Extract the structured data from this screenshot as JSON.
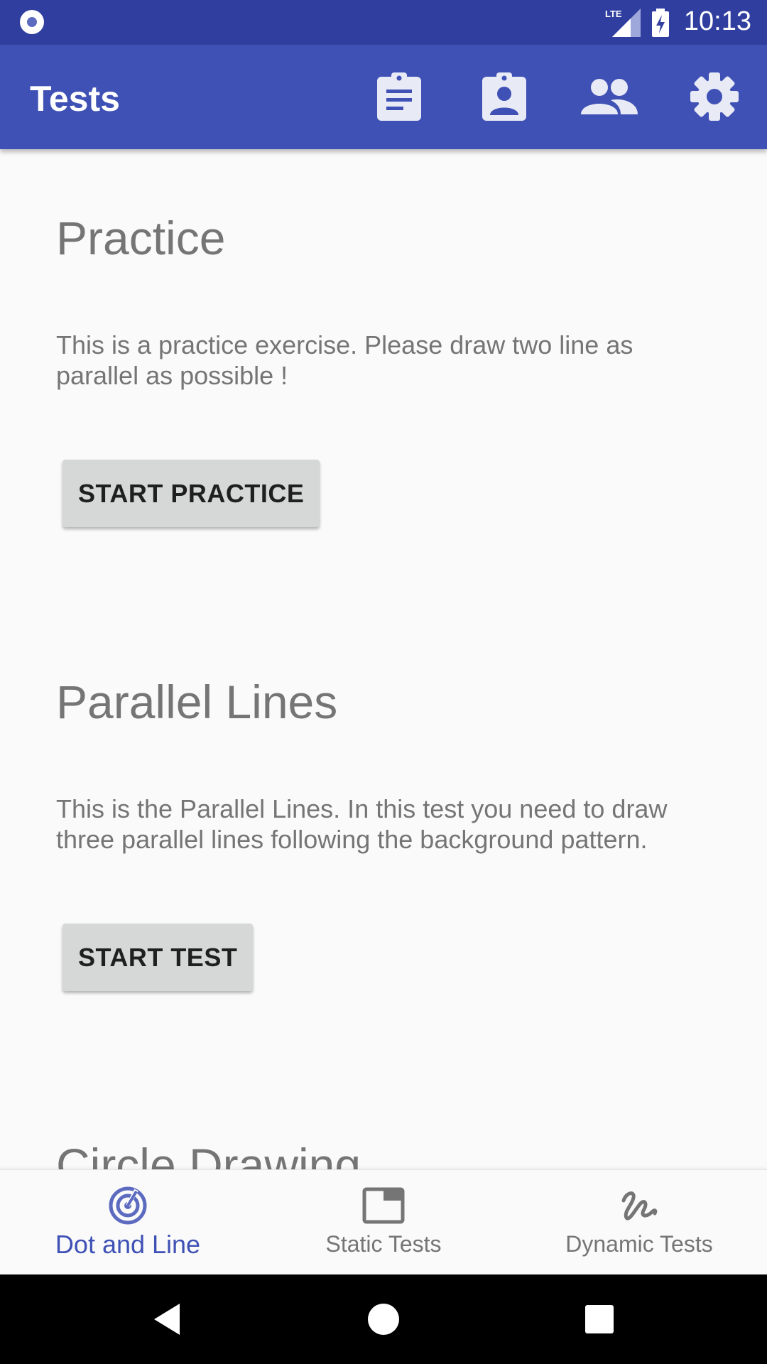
{
  "status_bar": {
    "network_label": "LTE",
    "time": "10:13"
  },
  "app_bar": {
    "title": "Tests",
    "actions": [
      {
        "name": "assignment-icon"
      },
      {
        "name": "assignment-ind-icon"
      },
      {
        "name": "people-icon"
      },
      {
        "name": "settings-icon"
      }
    ]
  },
  "sections": [
    {
      "title": "Practice",
      "description": "This is a practice exercise. Please draw two line as parallel as possible !",
      "button_label": "START PRACTICE"
    },
    {
      "title": "Parallel Lines",
      "description": "This is the Parallel Lines. In this test you need to draw three parallel lines following the background pattern.",
      "button_label": "START TEST"
    },
    {
      "title": "Circle Drawing"
    }
  ],
  "bottom_nav": {
    "items": [
      {
        "label": "Dot and Line",
        "icon": "target-icon",
        "active": true
      },
      {
        "label": "Static Tests",
        "icon": "window-icon",
        "active": false
      },
      {
        "label": "Dynamic Tests",
        "icon": "gesture-icon",
        "active": false
      }
    ]
  },
  "colors": {
    "primary": "#3f51b5",
    "primary_dark": "#303f9f",
    "background": "#fafafa",
    "text_secondary": "#757575",
    "button": "#d6d7d7"
  }
}
